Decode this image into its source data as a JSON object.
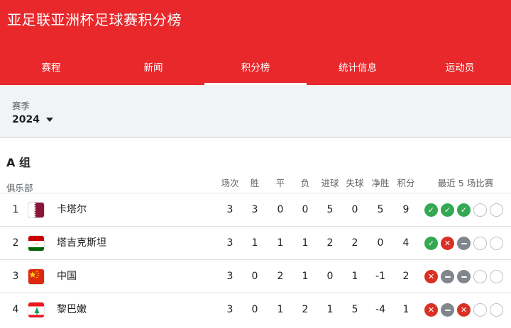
{
  "header": {
    "title": "亚足联亚洲杯足球赛积分榜",
    "tabs": [
      {
        "label": "赛程",
        "active": false
      },
      {
        "label": "新闻",
        "active": false
      },
      {
        "label": "积分榜",
        "active": true
      },
      {
        "label": "统计信息",
        "active": false
      },
      {
        "label": "运动员",
        "active": false
      }
    ]
  },
  "season": {
    "label": "赛季",
    "value": "2024"
  },
  "group": {
    "title": "A 组",
    "club_label": "俱乐部",
    "columns": [
      "场次",
      "胜",
      "平",
      "负",
      "进球",
      "失球",
      "净胜",
      "积分"
    ],
    "form_label": "最近 5 场比赛",
    "rows": [
      {
        "rank": "1",
        "team": "卡塔尔",
        "flag": "qatar-flag-icon",
        "stats": [
          "3",
          "3",
          "0",
          "0",
          "5",
          "0",
          "5",
          "9"
        ],
        "form": [
          "win",
          "win",
          "win",
          "empty",
          "empty"
        ]
      },
      {
        "rank": "2",
        "team": "塔吉克斯坦",
        "flag": "tajikistan-flag-icon",
        "stats": [
          "3",
          "1",
          "1",
          "1",
          "2",
          "2",
          "0",
          "4"
        ],
        "form": [
          "win",
          "loss",
          "draw",
          "empty",
          "empty"
        ]
      },
      {
        "rank": "3",
        "team": "中国",
        "flag": "china-flag-icon",
        "stats": [
          "3",
          "0",
          "2",
          "1",
          "0",
          "1",
          "-1",
          "2"
        ],
        "form": [
          "loss",
          "draw",
          "draw",
          "empty",
          "empty"
        ]
      },
      {
        "rank": "4",
        "team": "黎巴嫩",
        "flag": "lebanon-flag-icon",
        "stats": [
          "3",
          "0",
          "1",
          "2",
          "1",
          "5",
          "-4",
          "1"
        ],
        "form": [
          "loss",
          "draw",
          "loss",
          "empty",
          "empty"
        ]
      }
    ]
  },
  "colors": {
    "header": "#e8282b",
    "win": "#34a853",
    "loss": "#d93025",
    "draw": "#80868b"
  }
}
